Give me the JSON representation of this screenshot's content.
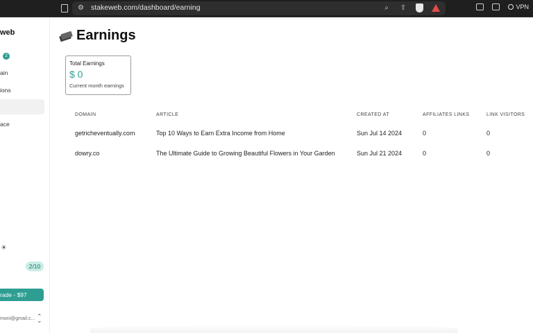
{
  "browser": {
    "url": "stakeweb.com/dashboard/earning",
    "vpn_label": "VPN"
  },
  "sidebar": {
    "brand": "web",
    "notification_count": "2",
    "items": [
      {
        "label": "ain"
      },
      {
        "label": "ions"
      },
      {
        "label": ""
      },
      {
        "label": "ace"
      }
    ],
    "usage": "2/10",
    "upgrade_label": "rade - $97",
    "email": "moni@gmail.c..."
  },
  "page": {
    "title": "Earnings"
  },
  "card": {
    "label": "Total Earnings",
    "value": "$ 0",
    "subtitle": "Current month earnings"
  },
  "table": {
    "headers": [
      "DOMAIN",
      "ARTICLE",
      "CREATED AT",
      "AFFILIATES LINKS",
      "LINK VISITORS"
    ],
    "rows": [
      {
        "domain": "getricheventually.com",
        "article": "Top 10 Ways to Earn Extra Income from Home",
        "created_at": "Sun Jul 14 2024",
        "affiliates_links": "0",
        "link_visitors": "0"
      },
      {
        "domain": "dowry.co",
        "article": "The Ultimate Guide to Growing Beautiful Flowers in Your Garden",
        "created_at": "Sun Jul 21 2024",
        "affiliates_links": "0",
        "link_visitors": "0"
      }
    ]
  },
  "colors": {
    "accent": "#2f9e92",
    "chrome_bg": "#1f1f1f"
  },
  "icons": [
    "bookmark-icon",
    "site-settings-icon",
    "zoom-icon",
    "share-icon",
    "brave-shield-icon",
    "brave-rewards-icon",
    "sidebar-toggle-icon",
    "wallet-icon",
    "vpn-globe-icon",
    "money-icon",
    "sun-icon",
    "chevron-updown-icon"
  ]
}
